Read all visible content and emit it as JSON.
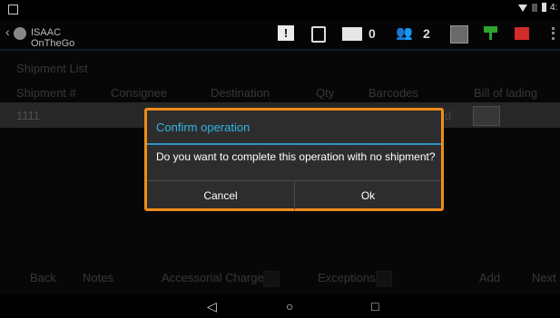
{
  "app": {
    "title": "ISAAC OnTheGo"
  },
  "status": {
    "time": "4:"
  },
  "action_bar": {
    "message_count": "0",
    "users_count": "2"
  },
  "screen": {
    "title": "Shipment List",
    "columns": [
      "Shipment #",
      "Consignee",
      "Destination",
      "Qty",
      "Barcodes",
      "Bill of lading"
    ],
    "rows": [
      {
        "shipment": "1111",
        "barcodes_tail": "d"
      }
    ],
    "bottom_buttons": {
      "back": "Back",
      "notes": "Notes",
      "accessorial": "Accessorial Charges",
      "exceptions": "Exceptions",
      "add": "Add",
      "next": "Next"
    }
  },
  "dialog": {
    "title": "Confirm operation",
    "message": "Do you want to complete this operation with no shipment?",
    "cancel": "Cancel",
    "ok": "Ok"
  },
  "colors": {
    "accent": "#35b4e5",
    "highlight": "#f08c19",
    "alert_green": "#2ea52e",
    "alert_red": "#d32a2a"
  }
}
